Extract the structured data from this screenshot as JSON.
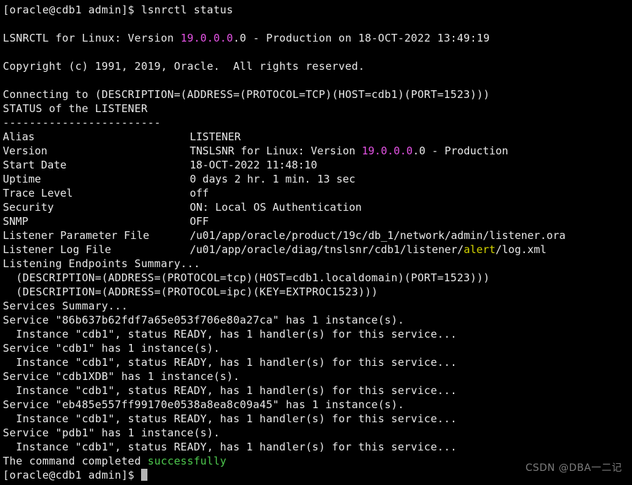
{
  "terminal": {
    "background_color": "#000000",
    "foreground_color": "#e8e8e8",
    "accent_magenta": "#e453e4",
    "accent_yellow": "#d2d200",
    "accent_green": "#4ec94e",
    "watermark": "CSDN @DBA一二记"
  },
  "prompt": {
    "top": "[oracle@cdb1 admin]$ ",
    "command": "lsnrctl status",
    "bottom": "[oracle@cdb1 admin]$ "
  },
  "banner": {
    "lsnrctl_prefix": "LSNRCTL for Linux: Version ",
    "version_highlight": "19.0.0.0",
    "version_tail": ".0",
    "lsnrctl_suffix": " - Production on 18-OCT-2022 13:49:19",
    "copyright": "Copyright (c) 1991, 2019, Oracle.  All rights reserved."
  },
  "connect": {
    "connecting": "Connecting to (DESCRIPTION=(ADDRESS=(PROTOCOL=TCP)(HOST=cdb1)(PORT=1523)))",
    "status_header": "STATUS of the LISTENER",
    "separator": "------------------------"
  },
  "details": {
    "alias": {
      "key": "Alias",
      "value": "LISTENER"
    },
    "version": {
      "key": "Version",
      "prefix": "TNSLSNR for Linux: Version ",
      "highlight": "19.0.0.0",
      "tail": ".0",
      "suffix": " - Production"
    },
    "start_date": {
      "key": "Start Date",
      "value": "18-OCT-2022 11:48:10"
    },
    "uptime": {
      "key": "Uptime",
      "value": "0 days 2 hr. 1 min. 13 sec"
    },
    "trace_level": {
      "key": "Trace Level",
      "value": "off"
    },
    "security": {
      "key": "Security",
      "value": "ON: Local OS Authentication"
    },
    "snmp": {
      "key": "SNMP",
      "value": "OFF"
    },
    "parameter_file": {
      "key": "Listener Parameter File",
      "value": "/u01/app/oracle/product/19c/db_1/network/admin/listener.ora"
    },
    "log_file": {
      "key": "Listener Log File",
      "prefix": "/u01/app/oracle/diag/tnslsnr/cdb1/listener/",
      "highlight": "alert",
      "suffix": "/log.xml"
    }
  },
  "endpoints": {
    "header": "Listening Endpoints Summary...",
    "entries": [
      "  (DESCRIPTION=(ADDRESS=(PROTOCOL=tcp)(HOST=cdb1.localdomain)(PORT=1523)))",
      "  (DESCRIPTION=(ADDRESS=(PROTOCOL=ipc)(KEY=EXTPROC1523)))"
    ]
  },
  "services": {
    "header": "Services Summary...",
    "entries": [
      {
        "service": "Service \"86b637b62fdf7a65e053f706e80a27ca\" has 1 instance(s).",
        "instance": "  Instance \"cdb1\", status READY, has 1 handler(s) for this service..."
      },
      {
        "service": "Service \"cdb1\" has 1 instance(s).",
        "instance": "  Instance \"cdb1\", status READY, has 1 handler(s) for this service..."
      },
      {
        "service": "Service \"cdb1XDB\" has 1 instance(s).",
        "instance": "  Instance \"cdb1\", status READY, has 1 handler(s) for this service..."
      },
      {
        "service": "Service \"eb485e557ff99170e0538a8ea8c09a45\" has 1 instance(s).",
        "instance": "  Instance \"cdb1\", status READY, has 1 handler(s) for this service..."
      },
      {
        "service": "Service \"pdb1\" has 1 instance(s).",
        "instance": "  Instance \"cdb1\", status READY, has 1 handler(s) for this service..."
      }
    ]
  },
  "result": {
    "prefix": "The command completed ",
    "status": "successfully"
  }
}
